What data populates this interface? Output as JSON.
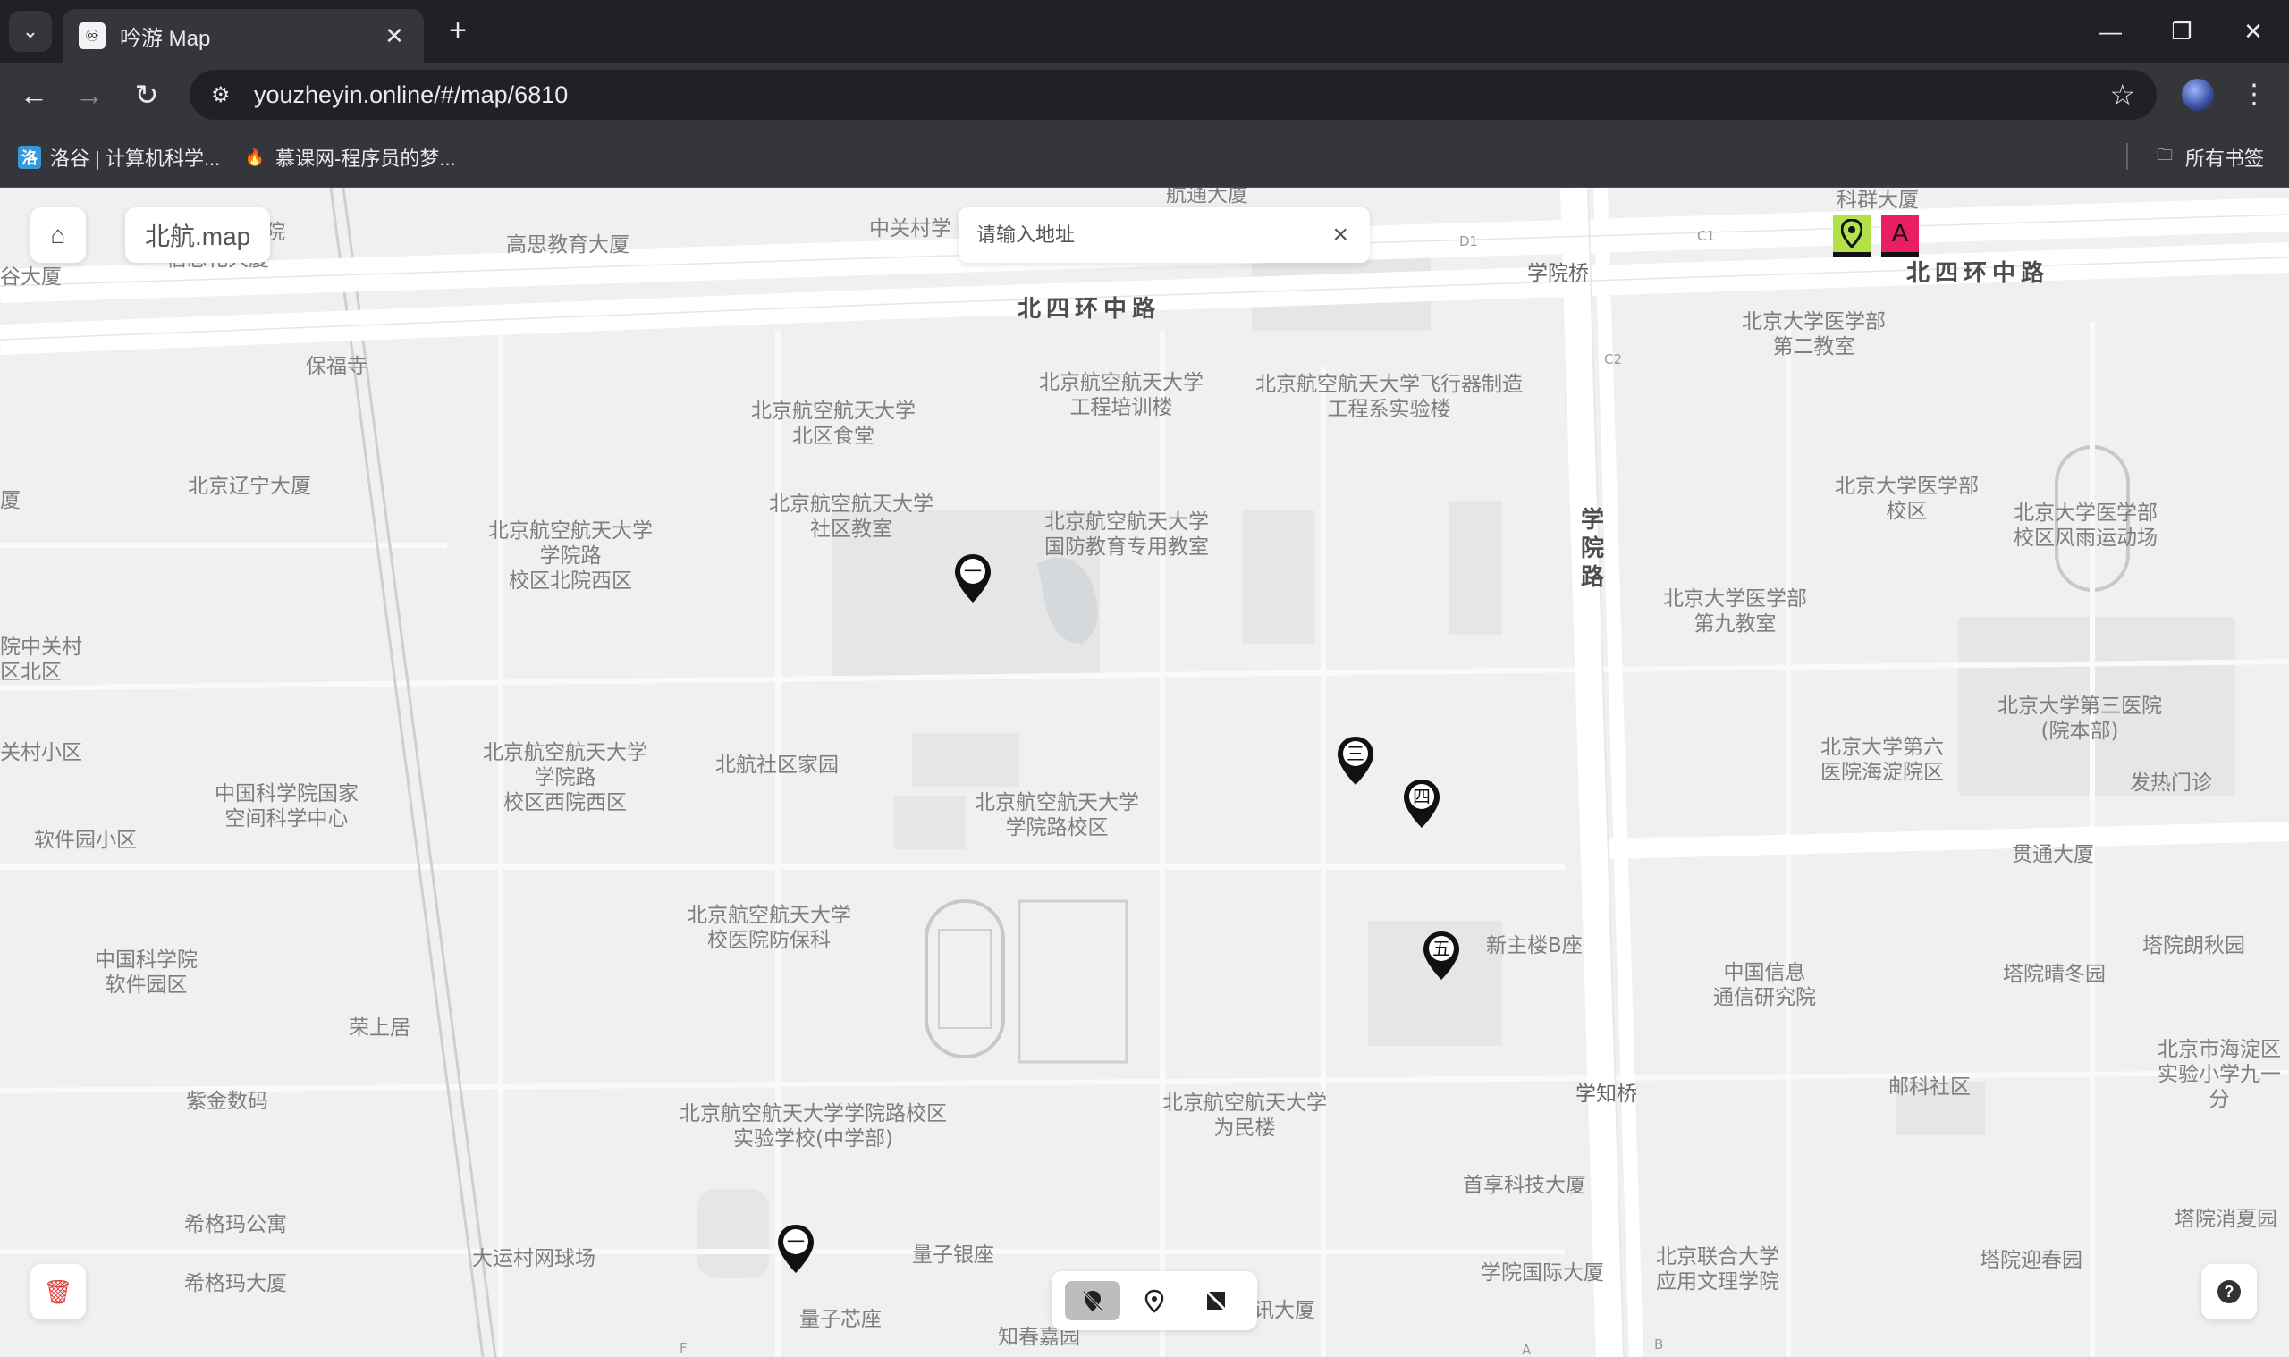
{
  "browser": {
    "tab_title": "吟游 Map",
    "tab_close": "✕",
    "url": "youzheyin.online/#/map/6810",
    "bookmarks": [
      {
        "label": "洛谷 | 计算机科学...",
        "icon": "luogu-icon",
        "color": "#3498db"
      },
      {
        "label": "慕课网-程序员的梦...",
        "icon": "flame-icon",
        "color": "#f44336"
      }
    ],
    "all_bookmarks": "所有书签"
  },
  "app": {
    "brand": "北航.map",
    "search_placeholder": "请输入地址",
    "legend": [
      {
        "name": "pin-legend-icon",
        "bg": "#b3e14a",
        "glyph": "⚲"
      },
      {
        "name": "text-legend-icon",
        "bg": "#e91e63",
        "glyph": "A"
      }
    ],
    "markers": [
      {
        "id": "marker-1",
        "glyph": "一"
      },
      {
        "id": "marker-2",
        "glyph": "三"
      },
      {
        "id": "marker-3",
        "glyph": "四"
      },
      {
        "id": "marker-4",
        "glyph": "五"
      },
      {
        "id": "marker-5",
        "glyph": "一"
      }
    ],
    "modes": [
      "hide-markers-icon",
      "add-marker-icon",
      "hide-labels-icon"
    ]
  },
  "map": {
    "roads": {
      "north_ring_west": "北四环中路",
      "north_ring_east": "北四环中路",
      "xueyuan_road": "学院路",
      "xueyuan_bridge": "学院桥",
      "xuezhi_bridge": "学知桥"
    },
    "places": [
      "航通大厦",
      "中关村学",
      "高思教育大厦",
      "院",
      "信息花大厦",
      "谷大厦",
      "保福寺",
      "北京航空航天大学\n北区食堂",
      "北京航空航天大学\n工程培训楼",
      "北京航空航天大学飞行器制造\n工程系实验楼",
      "科群大厦",
      "北京大学医学部\n第二教室",
      "北京辽宁大厦",
      "厦",
      "北京航空航天大学\n学院路\n校区北院西区",
      "北京航空航天大学\n社区教室",
      "北京航空航天大学\n国防教育专用教室",
      "北京大学医学部\n校区",
      "北京大学医学部\n校区风雨运动场",
      "北京大学医学部\n第九教室",
      "院中关村\n区北区",
      "北京大学第三医院\n(院本部)",
      "关村小区",
      "北京航空航天大学\n学院路\n校区西院西区",
      "北航社区家园",
      "北京航空航天大学\n学院路校区",
      "北京大学第六\n医院海淀院区",
      "发热门诊",
      "中国科学院国家\n空间科学中心",
      "软件园小区",
      "贯通大厦",
      "北京航空航天大学\n校医院防保科",
      "新主楼B座",
      "中国科学院\n软件园区",
      "塔院朗秋园",
      "中国信息\n通信研究院",
      "塔院晴冬园",
      "荣上居",
      "北京市海淀区\n实验小学九一分",
      "北京航空航天大学学院路校区\n实验学校(中学部)",
      "紫金数码",
      "北京航空航天大学\n为民楼",
      "邮科社区",
      "首享科技大厦",
      "希格玛公寓",
      "塔院消夏园",
      "大运村网球场",
      "量子银座",
      "北京联合大学\n应用文理学院",
      "塔院迎春园",
      "学院国际大厦",
      "希格玛大厦",
      "量子芯座",
      "讯大厦",
      "知春嘉园",
      "D1",
      "C1",
      "C2",
      "A",
      "B",
      "F"
    ]
  }
}
